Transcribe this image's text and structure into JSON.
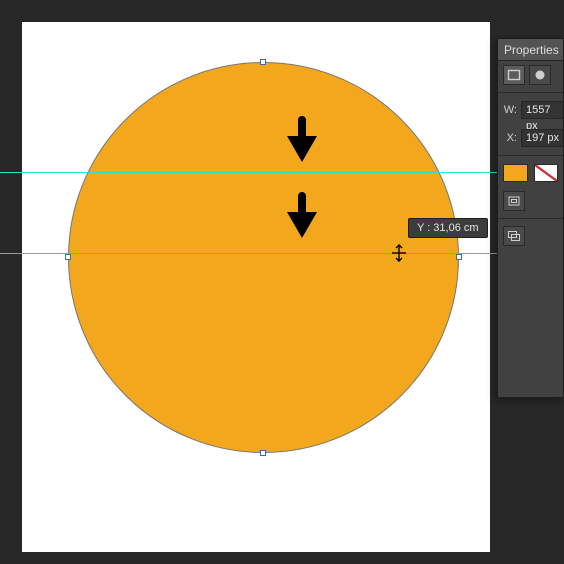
{
  "colors": {
    "sun": "#f2a71d"
  },
  "guide_tooltip": "Y : 31,06 cm",
  "arrows": [
    "tutorial-arrow-1",
    "tutorial-arrow-2"
  ],
  "properties_panel": {
    "title": "Properties",
    "width": {
      "label": "W:",
      "value": "1557 px"
    },
    "x": {
      "label": "X:",
      "value": "197 px"
    },
    "fill_swatch": "#f2a71d",
    "stroke_swatch": "none"
  }
}
